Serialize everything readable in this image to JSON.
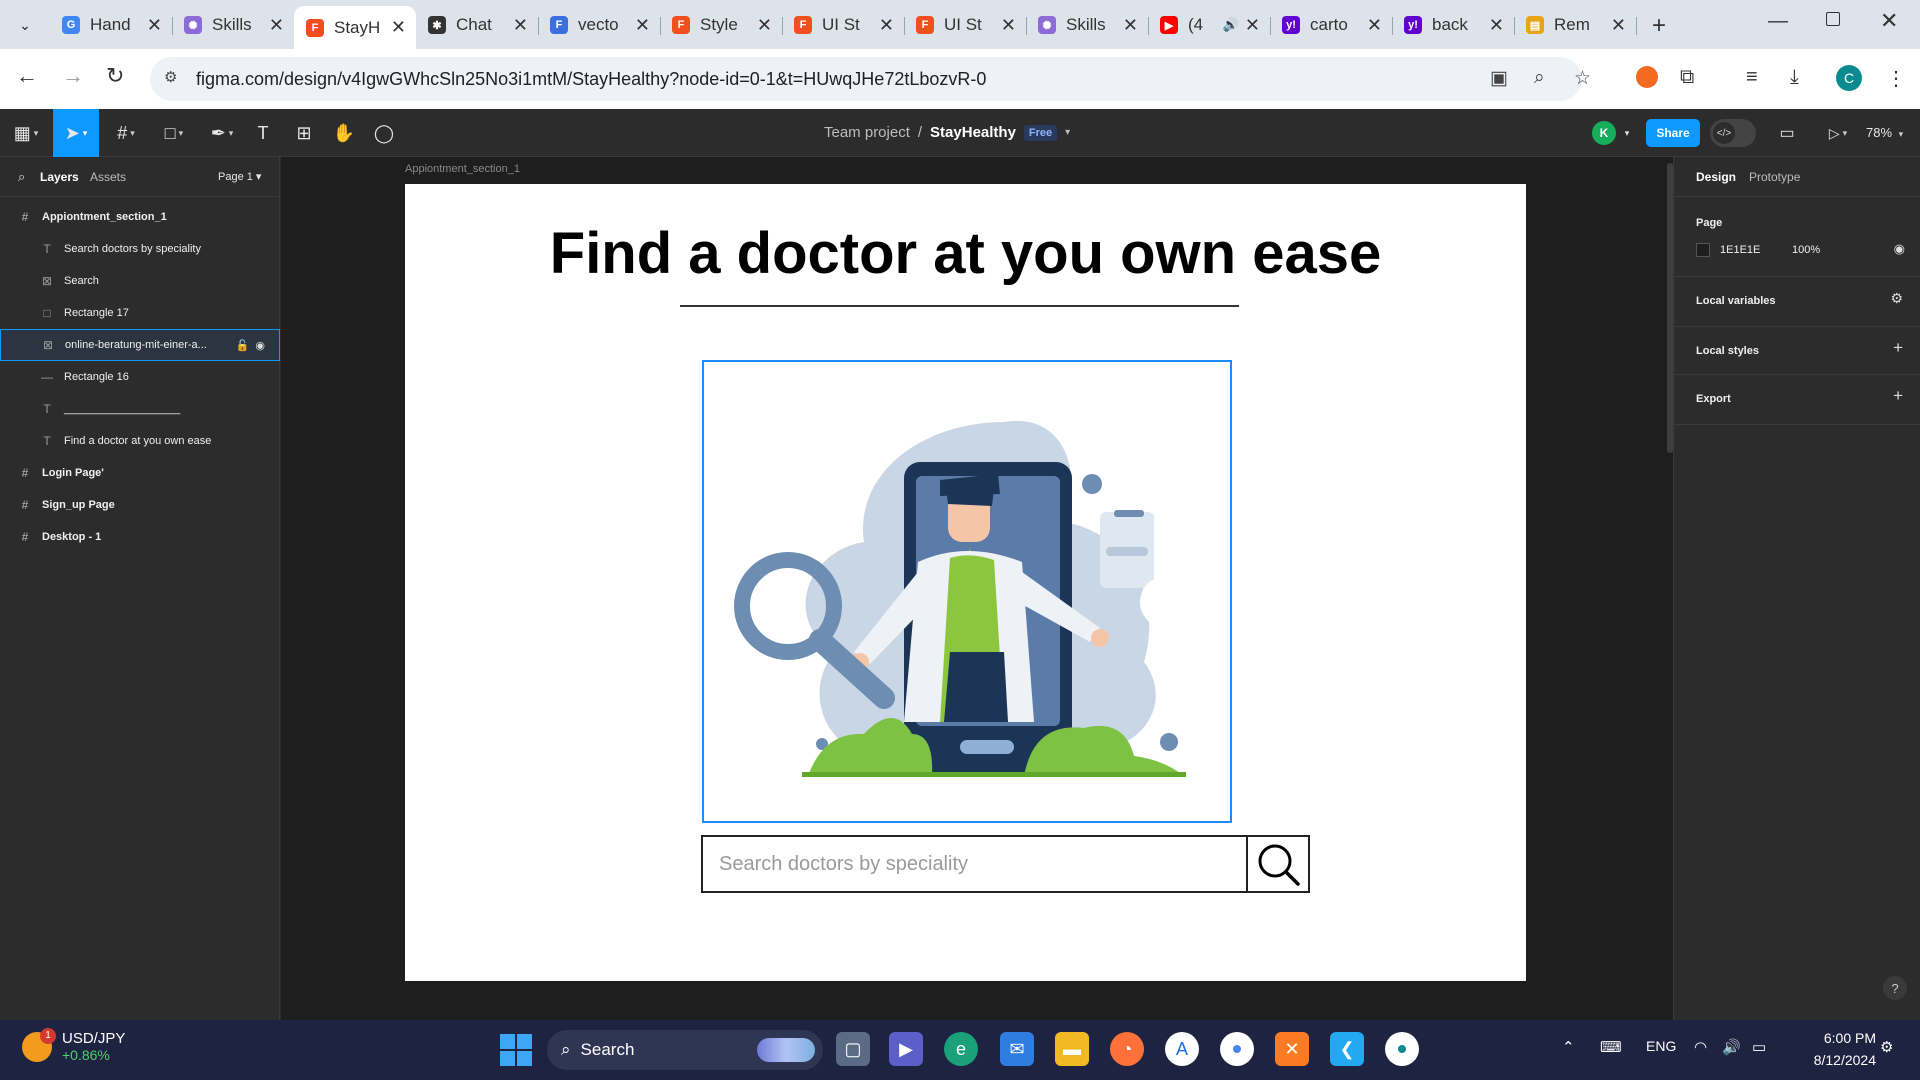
{
  "browser": {
    "tabs": [
      {
        "title": "Hand",
        "favicon": "google-icon",
        "color": "#4285f4",
        "glyph": "G"
      },
      {
        "title": "Skills",
        "favicon": "skills-icon",
        "color": "#8b6bd6",
        "glyph": "✺"
      },
      {
        "title": "StayH",
        "favicon": "figma-icon",
        "color": "#f24e1e",
        "glyph": "F",
        "active": true
      },
      {
        "title": "Chat",
        "favicon": "chatgpt-icon",
        "color": "#333333",
        "glyph": "✱"
      },
      {
        "title": "vecto",
        "favicon": "forms-icon",
        "color": "#3b6fe0",
        "glyph": "F"
      },
      {
        "title": "Style",
        "favicon": "figma-icon",
        "color": "#f24e1e",
        "glyph": "F"
      },
      {
        "title": "UI St",
        "favicon": "figma-icon",
        "color": "#f24e1e",
        "glyph": "F"
      },
      {
        "title": "UI St",
        "favicon": "figma-icon",
        "color": "#f24e1e",
        "glyph": "F"
      },
      {
        "title": "Skills",
        "favicon": "skills-icon",
        "color": "#8b6bd6",
        "glyph": "✺"
      },
      {
        "title": "(4",
        "favicon": "youtube-icon",
        "color": "#ff0000",
        "glyph": "▶",
        "audio": "🔊"
      },
      {
        "title": "carto",
        "favicon": "yahoo-icon",
        "color": "#6001d2",
        "glyph": "y!"
      },
      {
        "title": "back",
        "favicon": "yahoo-icon",
        "color": "#6001d2",
        "glyph": "y!"
      },
      {
        "title": "Rem",
        "favicon": "course-icon",
        "color": "#e8a417",
        "glyph": "▤"
      }
    ],
    "close_glyph": "✕",
    "new_tab": "+",
    "url": "figma.com/design/v4IgwGWhcSln25No3i1mtM/StayHealthy?node-id=0-1&t=HUwqJHe72tLbozvR-0",
    "profile_initial": "C"
  },
  "figma": {
    "breadcrumb_team": "Team project",
    "breadcrumb_sep": "/",
    "file_name": "StayHealthy",
    "plan_badge": "Free",
    "user_initial": "K",
    "share_label": "Share",
    "zoom": "78%",
    "left_panel": {
      "tab_layers": "Layers",
      "tab_assets": "Assets",
      "page": "Page 1",
      "layers": [
        {
          "name": "Appiontment_section_1",
          "type": "frame",
          "indent": 0
        },
        {
          "name": "Search doctors by speciality",
          "type": "text",
          "indent": 1
        },
        {
          "name": "Search",
          "type": "image",
          "indent": 1
        },
        {
          "name": "Rectangle 17",
          "type": "rect",
          "indent": 1
        },
        {
          "name": "online-beratung-mit-einer-a...",
          "type": "image",
          "indent": 1,
          "selected": true
        },
        {
          "name": "Rectangle 16",
          "type": "line",
          "indent": 1
        },
        {
          "name": "___________________",
          "type": "text",
          "indent": 1
        },
        {
          "name": "Find a doctor at you own ease",
          "type": "text",
          "indent": 1
        },
        {
          "name": "Login Page'",
          "type": "frame",
          "indent": 0
        },
        {
          "name": "Sign_up Page",
          "type": "frame",
          "indent": 0
        },
        {
          "name": "Desktop - 1",
          "type": "frame",
          "indent": 0
        }
      ]
    },
    "canvas": {
      "frame_label": "Appiontment_section_1",
      "headline": "Find a doctor at you own ease",
      "search_placeholder": "Search doctors by speciality"
    },
    "right_panel": {
      "tab_design": "Design",
      "tab_prototype": "Prototype",
      "page_title": "Page",
      "page_color": "1E1E1E",
      "page_opacity": "100%",
      "local_variables": "Local variables",
      "local_styles": "Local styles",
      "export": "Export",
      "help": "?"
    }
  },
  "taskbar": {
    "ticker_name": "USD/JPY",
    "ticker_change": "+0.86%",
    "notification_count": "1",
    "search_label": "Search",
    "language": "ENG",
    "time": "6:00 PM",
    "date": "8/12/2024"
  },
  "colors": {
    "accent": "#0d99ff",
    "selection": "#1a8cff",
    "illustration_blue": "#6d8db3",
    "illustration_green": "#7dc242"
  }
}
